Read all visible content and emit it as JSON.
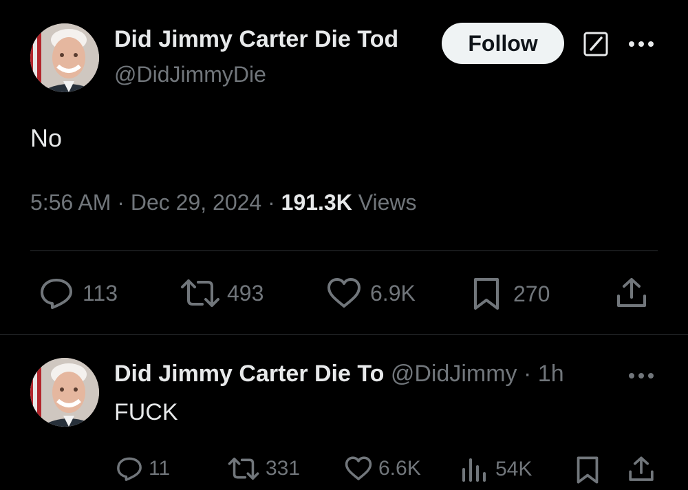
{
  "colors": {
    "background": "#000000",
    "primary_text": "#e7e9ea",
    "secondary_text": "#71767b",
    "divider": "#2f3336",
    "follow_button_bg": "#eff3f4",
    "follow_button_text": "#0f1419"
  },
  "main_tweet": {
    "avatar_icon": "profile-photo",
    "display_name": "Did Jimmy Carter Die Tod",
    "handle": "@DidJimmyDie",
    "follow_label": "Follow",
    "grok_icon": "grok-icon",
    "more_icon": "more-dots-icon",
    "text": "No",
    "meta": {
      "time": "5:56 AM",
      "sep1": "·",
      "date": "Dec 29, 2024",
      "sep2": "·",
      "views_count": "191.3K",
      "views_label": "Views"
    },
    "actions": {
      "replies": "113",
      "reposts": "493",
      "likes": "6.9K",
      "bookmarks": "270"
    }
  },
  "reply_tweet": {
    "avatar_icon": "profile-photo",
    "display_name": "Did Jimmy Carter Die To",
    "handle": "@DidJimmy",
    "sep": "·",
    "time_ago": "1h",
    "text": "FUCK",
    "actions": {
      "replies": "11",
      "reposts": "331",
      "likes": "6.6K",
      "views": "54K"
    }
  }
}
